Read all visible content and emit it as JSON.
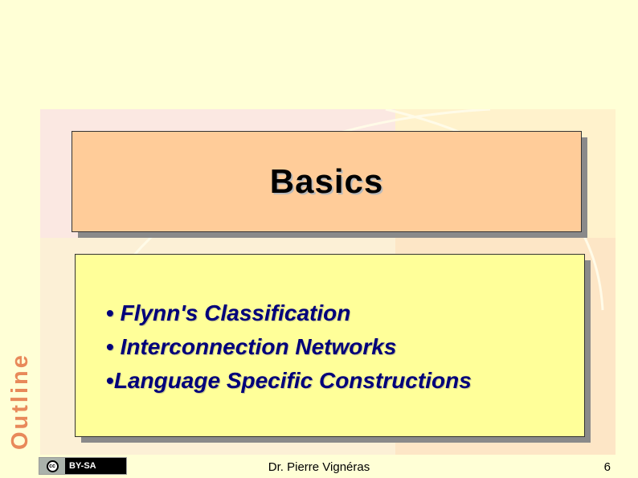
{
  "slide": {
    "title": "Basics",
    "bullets": [
      {
        "marker": "• ",
        "text": "Flynn's Classification"
      },
      {
        "marker": "• ",
        "text": "Interconnection Networks"
      },
      {
        "marker": "•",
        "text": "Language Specific Constructions"
      }
    ],
    "side_label": "Outline"
  },
  "footer": {
    "license_symbol": "cc",
    "license_label": "BY-SA",
    "author": "Dr. Pierre Vignéras",
    "page_number": "6"
  },
  "colors": {
    "page_background": "#ffffd6",
    "title_box": "#ffcc99",
    "content_box": "#ffff99",
    "bullet_text": "#00007a",
    "side_label": "#e8895a"
  }
}
